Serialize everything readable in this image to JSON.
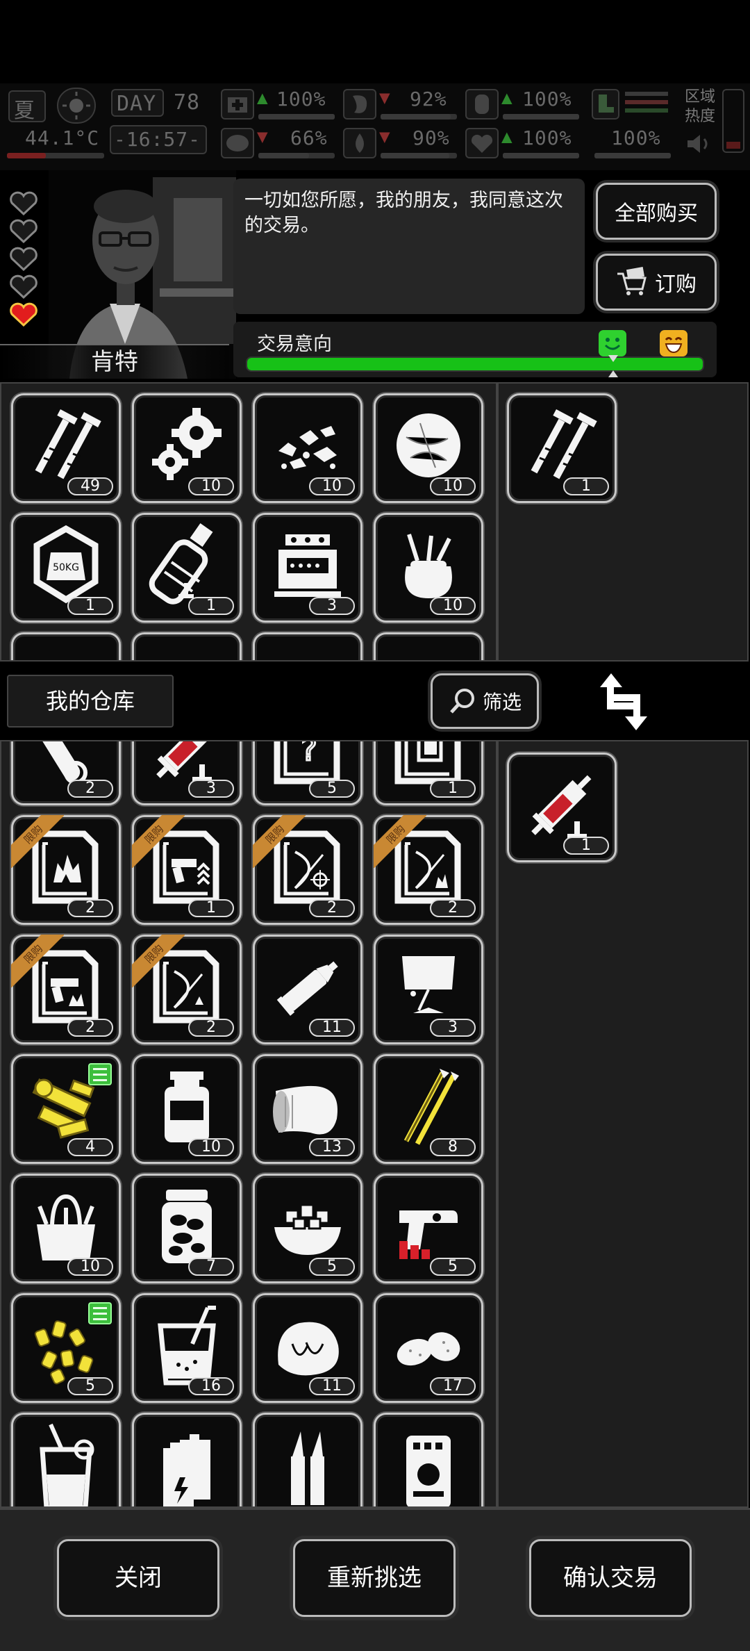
{
  "hud": {
    "season": "夏",
    "day_label": "DAY",
    "day_number": "78",
    "temperature": "44.1°C",
    "time": "-16:57-",
    "stats": [
      {
        "name": "health",
        "value": "100%",
        "trend": "up"
      },
      {
        "name": "stomach",
        "value": "92%",
        "trend": "down"
      },
      {
        "name": "armor",
        "value": "100%",
        "trend": "up"
      },
      {
        "name": "sanity",
        "value": "66%",
        "trend": "down"
      },
      {
        "name": "thirst",
        "value": "90%",
        "trend": "down"
      },
      {
        "name": "heart",
        "value": "100%",
        "trend": "up"
      },
      {
        "name": "noise",
        "value": "100%",
        "trend": "none"
      }
    ],
    "zone_heat_label": "区域热度"
  },
  "trader": {
    "name": "肯特",
    "dialog": "一切如您所愿，我的朋友，我同意这次的交易。",
    "buy_all_label": "全部购买",
    "order_label": "订购",
    "intent_label": "交易意向",
    "intent_level": 1.0,
    "hearts": [
      false,
      false,
      false,
      false,
      true
    ]
  },
  "trader_inventory": [
    {
      "icon": "nails-icon",
      "count": "49"
    },
    {
      "icon": "gears-icon",
      "count": "10"
    },
    {
      "icon": "rubble-icon",
      "count": "10"
    },
    {
      "icon": "cotton-icon",
      "count": "10"
    },
    {
      "icon": "weight-icon",
      "count": "1"
    },
    {
      "icon": "gas-canister-icon",
      "count": "1"
    },
    {
      "icon": "radio-device-icon",
      "count": "3"
    },
    {
      "icon": "tool-bag-icon",
      "count": "10"
    }
  ],
  "trader_offer": [
    {
      "icon": "nails-icon",
      "count": "1"
    }
  ],
  "warehouse": {
    "title": "我的仓库",
    "filter_label": "筛选",
    "ribbon_label": "限购",
    "items": [
      {
        "icon": "scroll-icon",
        "count": "2"
      },
      {
        "icon": "syringe-icon",
        "count": "3"
      },
      {
        "icon": "blueprint-unknown-icon",
        "count": "5"
      },
      {
        "icon": "blueprint-armor-icon",
        "count": "1"
      },
      {
        "icon": "blueprint-fire-icon",
        "count": "2",
        "limited": true
      },
      {
        "icon": "blueprint-gun-upgrade-icon",
        "count": "1",
        "limited": true
      },
      {
        "icon": "blueprint-bow-scope-icon",
        "count": "2",
        "limited": true
      },
      {
        "icon": "blueprint-bow-fire-icon",
        "count": "2",
        "limited": true
      },
      {
        "icon": "blueprint-gun-icon",
        "count": "2",
        "limited": true
      },
      {
        "icon": "blueprint-bow-icon",
        "count": "2",
        "limited": true
      },
      {
        "icon": "glue-tube-icon",
        "count": "11"
      },
      {
        "icon": "lamp-icon",
        "count": "3"
      },
      {
        "icon": "gun-parts-icon",
        "count": "4",
        "badge": true
      },
      {
        "icon": "bottle-icon",
        "count": "10"
      },
      {
        "icon": "bandage-icon",
        "count": "13"
      },
      {
        "icon": "arrows-icon",
        "count": "8"
      },
      {
        "icon": "toolbox-icon",
        "count": "10"
      },
      {
        "icon": "pickle-jar-icon",
        "count": "7"
      },
      {
        "icon": "food-bowl-icon",
        "count": "5"
      },
      {
        "icon": "flare-gun-icon",
        "count": "5"
      },
      {
        "icon": "bullets-icon",
        "count": "5",
        "badge": true
      },
      {
        "icon": "drink-glass-icon",
        "count": "16"
      },
      {
        "icon": "meat-icon",
        "count": "11"
      },
      {
        "icon": "potato-icon",
        "count": "17"
      },
      {
        "icon": "juice-icon",
        "count": ""
      },
      {
        "icon": "battery-icon",
        "count": ""
      },
      {
        "icon": "ammo-rounds-icon",
        "count": ""
      },
      {
        "icon": "machine-part-icon",
        "count": ""
      }
    ]
  },
  "player_offer": [
    {
      "icon": "syringe-icon",
      "count": "1"
    }
  ],
  "footer": {
    "close_label": "关闭",
    "reselect_label": "重新挑选",
    "confirm_label": "确认交易"
  }
}
